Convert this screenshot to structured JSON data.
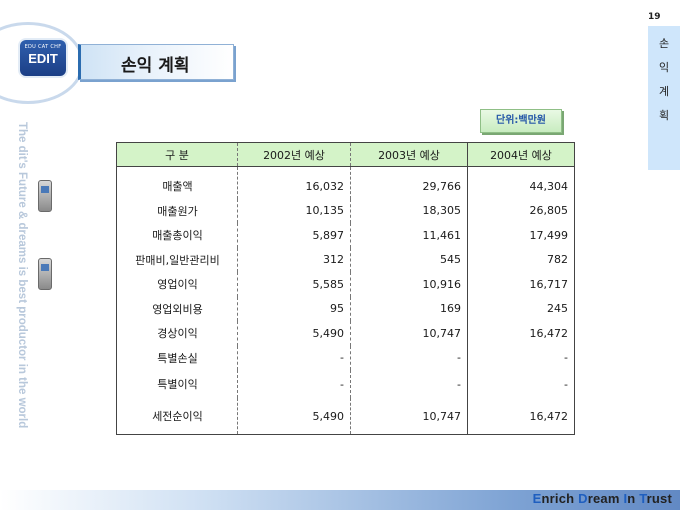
{
  "logo": {
    "small": "EDU CAT CHF",
    "big": "EDIT"
  },
  "title": "손익 계획",
  "vertical_tagline": "The  dit's Future & dreams is best productor in the world",
  "page_number": "19",
  "side_label": [
    "손",
    "익",
    "계",
    "획"
  ],
  "unit": "단위:백만원",
  "table": {
    "headers": [
      "구  분",
      "2002년 예상",
      "2003년 예상",
      "2004년 예상"
    ],
    "rows": [
      [
        "매출액",
        "16,032",
        "29,766",
        "44,304"
      ],
      [
        "매출원가",
        "10,135",
        "18,305",
        "26,805"
      ],
      [
        "매출총이익",
        "5,897",
        "11,461",
        "17,499"
      ],
      [
        "판매비,일반관리비",
        "312",
        "545",
        "782"
      ],
      [
        "영업이익",
        "5,585",
        "10,916",
        "16,717"
      ],
      [
        "영업외비용",
        "95",
        "169",
        "245"
      ],
      [
        "경상이익",
        "5,490",
        "10,747",
        "16,472"
      ],
      [
        "특별손실",
        "-",
        "-",
        "-"
      ],
      [
        "특별이익",
        "-",
        "-",
        "-"
      ],
      [
        "세전순이익",
        "5,490",
        "10,747",
        "16,472"
      ]
    ]
  },
  "slogan": {
    "w1_cap": "E",
    "w1_rest": "nrich ",
    "w2_cap": "D",
    "w2_rest": "ream ",
    "w3_cap": "I",
    "w3_rest": "n ",
    "w4_cap": "T",
    "w4_rest": "rust"
  }
}
